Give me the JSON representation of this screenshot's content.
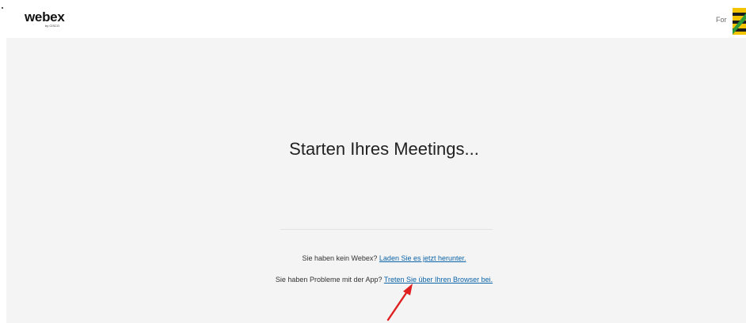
{
  "header": {
    "logo_text": "webex",
    "logo_sub": "by CISCO",
    "right_text": "For",
    "crest_icon": "coat-of-arms-icon"
  },
  "main": {
    "headline": "Starten Ihres Meetings...",
    "download_prompt": "Sie haben kein Webex?",
    "download_link": "Laden Sie es jetzt herunter.",
    "browser_prompt": "Sie haben Probleme mit der App?",
    "browser_link": "Treten Sie über Ihren Browser bei."
  },
  "annotation": {
    "arrow_icon": "red-arrow-icon",
    "color": "#e02020"
  },
  "colors": {
    "link": "#0b63a8",
    "panel_background": "#f4f4f4"
  }
}
